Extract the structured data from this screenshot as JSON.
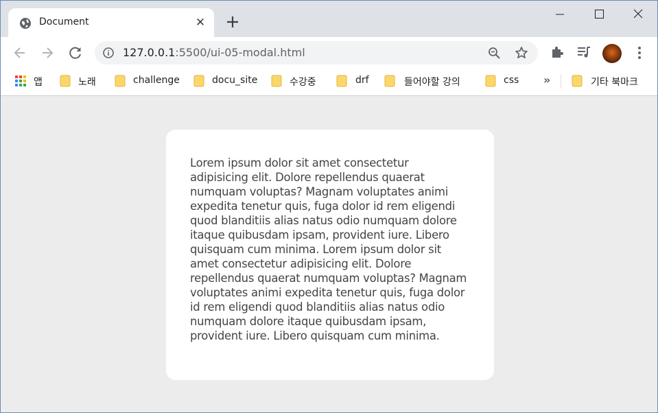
{
  "tab": {
    "title": "Document",
    "close_glyph": "✕",
    "favicon": "globe-icon"
  },
  "window_controls": [
    "minimize-icon",
    "maximize-icon",
    "close-icon"
  ],
  "toolbar": {
    "url_host": "127.0.0.1",
    "url_rest": ":5500/ui-05-modal.html"
  },
  "bookmarks": {
    "apps_label": "앱",
    "items": [
      {
        "label": "노래"
      },
      {
        "label": "challenge"
      },
      {
        "label": "docu_site"
      },
      {
        "label": "수강중"
      },
      {
        "label": "drf"
      },
      {
        "label": "들어야할 강의"
      },
      {
        "label": "css"
      }
    ],
    "overflow": "»",
    "other_label": "기타 북마크"
  },
  "modal": {
    "text": "Lorem ipsum dolor sit amet consectetur adipisicing elit. Dolore repellendus quaerat numquam voluptas? Magnam voluptates animi expedita tenetur quis, fuga dolor id rem eligendi quod blanditiis alias natus odio numquam dolore itaque quibusdam ipsam, provident iure. Libero quisquam cum minima. Lorem ipsum dolor sit amet consectetur adipisicing elit. Dolore repellendus quaerat numquam voluptas? Magnam voluptates animi expedita tenetur quis, fuga dolor id rem eligendi quod blanditiis alias natus odio numquam dolore itaque quibusdam ipsam, provident iure. Libero quisquam cum minima."
  },
  "colors": {
    "tabstrip": "#dee1e6",
    "page_background": "#ececec",
    "modal_background": "#ffffff",
    "folder": "#fbd76b"
  }
}
